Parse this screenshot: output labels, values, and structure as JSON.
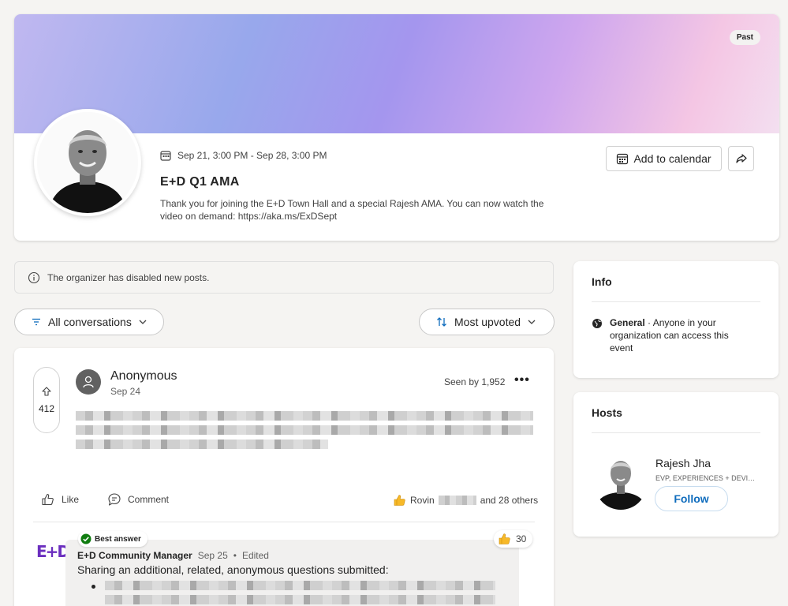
{
  "event": {
    "status_badge": "Past",
    "date_range": "Sep 21, 3:00 PM - Sep 28, 3:00 PM",
    "title": "E+D Q1 AMA",
    "description": "Thank you for joining the E+D Town Hall and a special Rajesh AMA. You can now watch the video on demand: https://aka.ms/ExDSept",
    "add_to_calendar_label": "Add to calendar",
    "share_icon": "share-icon",
    "calendar_icon": "calendar-icon"
  },
  "notice": {
    "text": "The organizer has disabled new posts.",
    "icon": "info-icon"
  },
  "filters": {
    "conversations_label": "All conversations",
    "sort_label": "Most upvoted"
  },
  "post": {
    "upvotes": "412",
    "author": "Anonymous",
    "date": "Sep 24",
    "seen_by": "Seen by 1,952",
    "more_label": "•••",
    "like_label": "Like",
    "comment_label": "Comment",
    "reaction_prefix": "Rovin",
    "reaction_suffix": "and 28 others"
  },
  "answer": {
    "badge_label": "Best answer",
    "author": "E+D Community Manager",
    "date": "Sep 25",
    "separator": "•",
    "edited_label": "Edited",
    "reaction_count": "30",
    "text": "Sharing an additional, related, anonymous questions submitted:",
    "logo_text": "E+D"
  },
  "info": {
    "title": "Info",
    "visibility_name": "General",
    "visibility_desc": " · Anyone in your organization can access this event"
  },
  "hosts": {
    "title": "Hosts",
    "items": [
      {
        "name": "Rajesh Jha",
        "title": "EVP, EXPERIENCES + DEVICES",
        "follow_label": "Follow"
      }
    ]
  },
  "colors": {
    "accent": "#0f6cbd",
    "brand_purple": "#6b2fbf",
    "success": "#107c10",
    "reaction_yellow": "#f7b928"
  }
}
